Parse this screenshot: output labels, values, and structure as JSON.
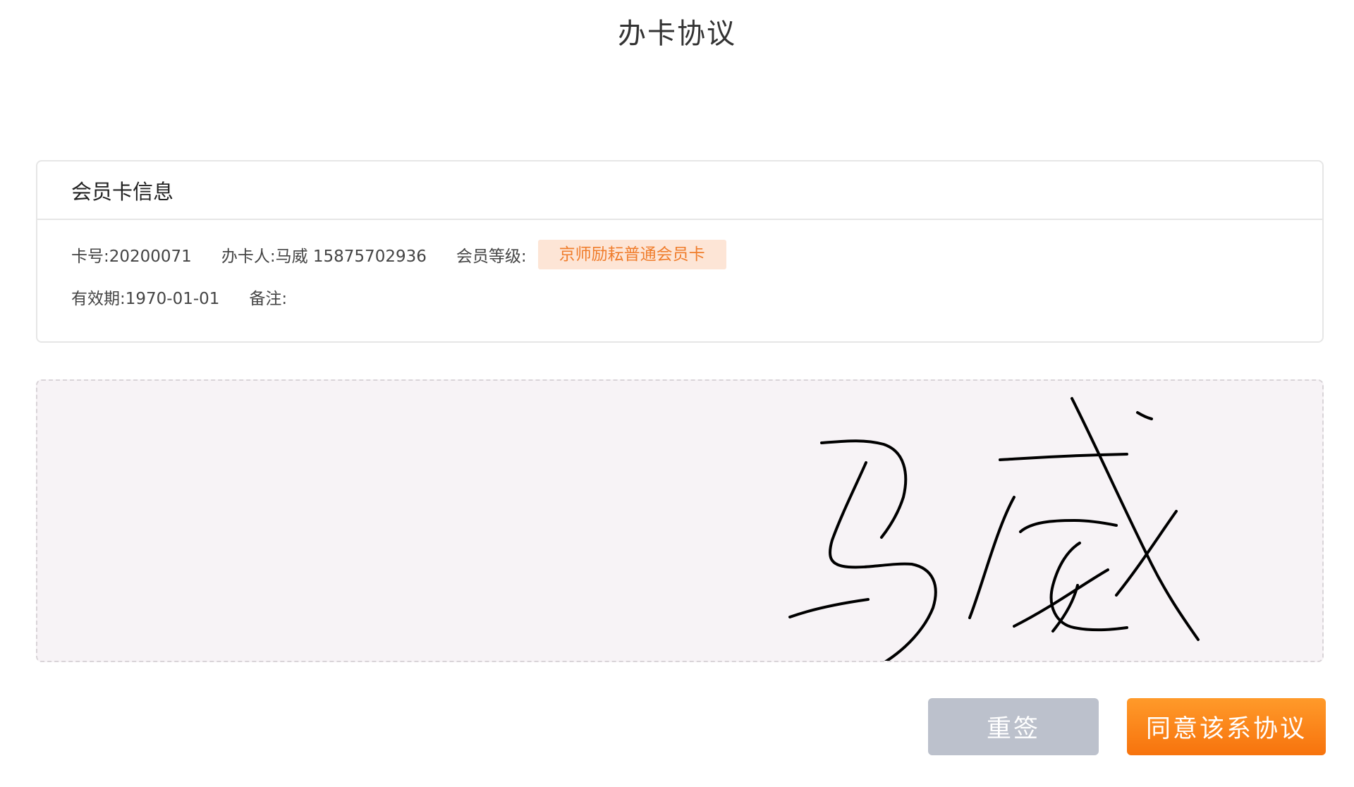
{
  "page": {
    "title": "办卡协议"
  },
  "card_info": {
    "header": "会员卡信息",
    "card_no": "卡号:20200071",
    "holder": "办卡人:马威 15875702936",
    "level_label": "会员等级:",
    "level_value": "京师励耘普通会员卡",
    "validity": "有效期:1970-01-01",
    "remark": "备注:"
  },
  "signature": {
    "signed_name": "马威"
  },
  "actions": {
    "reset_label": "重签",
    "agree_label": "同意该系协议"
  },
  "colors": {
    "accent": "#f7730d",
    "badge_bg": "#fde5d6",
    "badge_text": "#f07d2c",
    "reset_bg": "#bcc1cc",
    "sign_bg": "#f7f3f6"
  }
}
